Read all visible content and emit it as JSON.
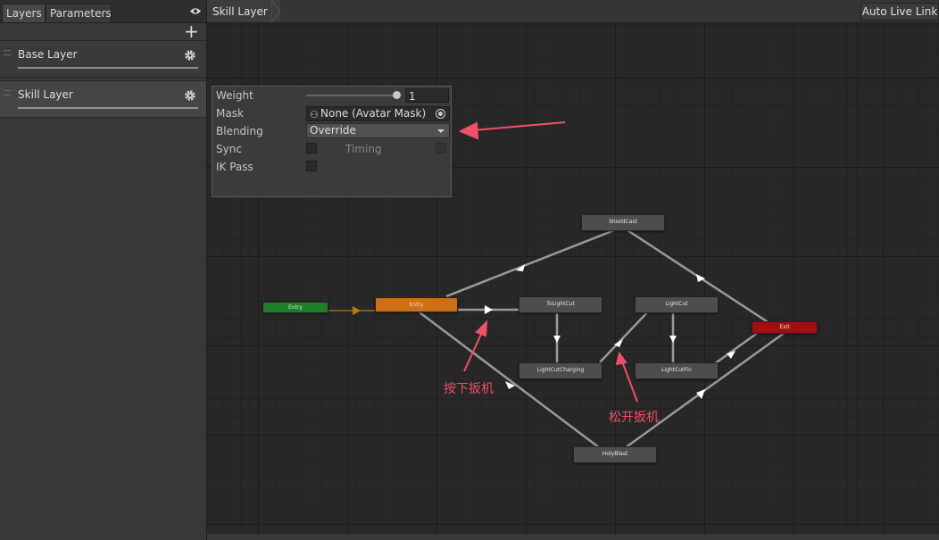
{
  "left_panel": {
    "tabs": {
      "layers": "Layers",
      "parameters": "Parameters"
    },
    "add_symbol": "+",
    "layers": [
      {
        "label": "Base Layer"
      },
      {
        "label": "Skill Layer"
      }
    ]
  },
  "header": {
    "breadcrumb": "Skill Layer",
    "auto_live_link": "Auto Live Link"
  },
  "layer_settings": {
    "weight_label": "Weight",
    "weight_value": "1",
    "weight_slider": 1.0,
    "mask_label": "Mask",
    "mask_value": "None (Avatar Mask)",
    "blending_label": "Blending",
    "blending_value": "Override",
    "sync_label": "Sync",
    "timing_label": "Timing",
    "ik_pass_label": "IK Pass"
  },
  "states": {
    "entry_green": "Entry",
    "entry_orange": "Entry",
    "shield_cast": "ShieldCast",
    "to_light_cut": "ToLightCut",
    "light_cut": "LightCut",
    "light_cut_charging": "LightCutCharging",
    "light_cut_fin": "LightCutFin",
    "exit": "Exit",
    "holy_blast": "HolyBlast"
  },
  "annotations": {
    "press_trigger": "按下扳机",
    "release_trigger": "松开扳机"
  },
  "colors": {
    "entry_green": "#1e7d26",
    "entry_orange": "#cc6f15",
    "exit_red": "#a11010",
    "annotation": "#f0506a"
  }
}
